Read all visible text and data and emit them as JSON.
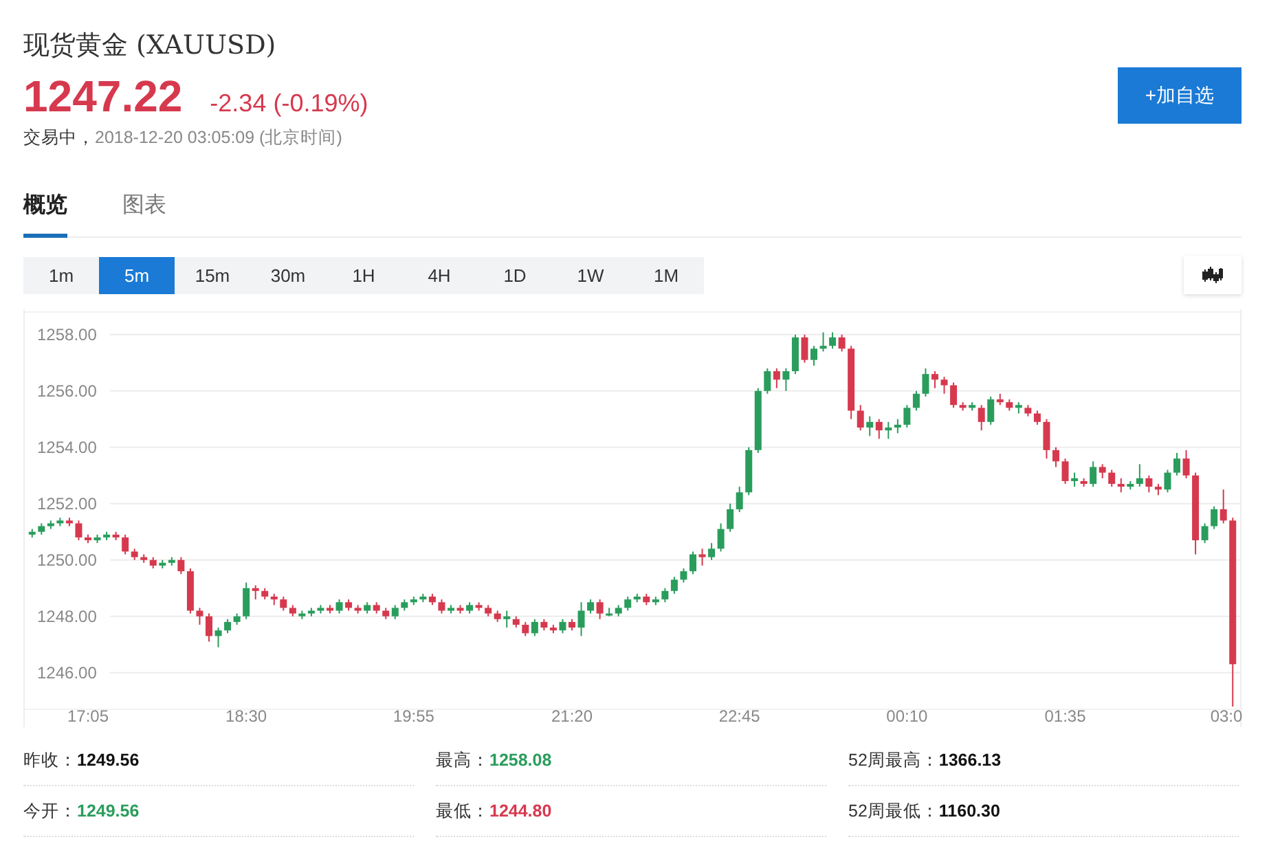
{
  "header": {
    "title": "现货黄金 (XAUUSD)",
    "price": "1247.22",
    "change": "-2.34 (-0.19%)",
    "color": "#d6394e",
    "status": "交易中，",
    "time": "2018-12-20 03:05:09 (北京时间)",
    "button": "+加自选"
  },
  "tabs": [
    {
      "label": "概览",
      "selected": true
    },
    {
      "label": "图表",
      "selected": false
    }
  ],
  "intervals": [
    {
      "label": "1m",
      "selected": false
    },
    {
      "label": "5m",
      "selected": true
    },
    {
      "label": "15m",
      "selected": false
    },
    {
      "label": "30m",
      "selected": false
    },
    {
      "label": "1H",
      "selected": false
    },
    {
      "label": "4H",
      "selected": false
    },
    {
      "label": "1D",
      "selected": false
    },
    {
      "label": "1W",
      "selected": false
    },
    {
      "label": "1M",
      "selected": false
    }
  ],
  "chart": {
    "chart_data": {
      "type": "candlestick",
      "grid": true,
      "ylim": [
        1244.7,
        1258.8
      ],
      "yticks": [
        {
          "value": 1258,
          "label": "1258.00"
        },
        {
          "value": 1256,
          "label": "1256.00"
        },
        {
          "value": 1254,
          "label": "1254.00"
        },
        {
          "value": 1252,
          "label": "1252.00"
        },
        {
          "value": 1250,
          "label": "1250.00"
        },
        {
          "value": 1248,
          "label": "1248.00"
        },
        {
          "value": 1246,
          "label": "1246.00"
        }
      ],
      "categories": [
        null,
        null,
        null,
        null,
        null,
        null,
        "17:05",
        null,
        null,
        null,
        null,
        null,
        null,
        null,
        null,
        null,
        null,
        null,
        null,
        null,
        null,
        null,
        null,
        "18:30",
        null,
        null,
        null,
        null,
        null,
        null,
        null,
        null,
        null,
        null,
        null,
        null,
        null,
        null,
        null,
        null,
        null,
        "19:55",
        null,
        null,
        null,
        null,
        null,
        null,
        null,
        null,
        null,
        null,
        null,
        null,
        null,
        null,
        null,
        null,
        "21:20",
        null,
        null,
        null,
        null,
        null,
        null,
        null,
        null,
        null,
        null,
        null,
        null,
        null,
        null,
        null,
        null,
        null,
        "22:45",
        null,
        null,
        null,
        null,
        null,
        null,
        null,
        null,
        null,
        null,
        null,
        null,
        null,
        null,
        null,
        null,
        null,
        "00:10",
        null,
        null,
        null,
        null,
        null,
        null,
        null,
        null,
        null,
        null,
        null,
        null,
        null,
        null,
        null,
        null,
        "01:35",
        null,
        null,
        null,
        null,
        null,
        null,
        null,
        null,
        null,
        null,
        null,
        null,
        null,
        null,
        null,
        null,
        null,
        "03:0"
      ],
      "ohlc": [
        [
          1250.9,
          1251.1,
          1250.8,
          1251.0
        ],
        [
          1251.0,
          1251.3,
          1250.9,
          1251.2
        ],
        [
          1251.2,
          1251.4,
          1251.1,
          1251.3
        ],
        [
          1251.3,
          1251.5,
          1251.2,
          1251.4
        ],
        [
          1251.4,
          1251.5,
          1251.2,
          1251.3
        ],
        [
          1251.3,
          1251.4,
          1250.7,
          1250.8
        ],
        [
          1250.8,
          1250.9,
          1250.6,
          1250.7
        ],
        [
          1250.7,
          1250.9,
          1250.6,
          1250.8
        ],
        [
          1250.8,
          1251.0,
          1250.7,
          1250.9
        ],
        [
          1250.9,
          1251.0,
          1250.7,
          1250.8
        ],
        [
          1250.8,
          1250.9,
          1250.2,
          1250.3
        ],
        [
          1250.3,
          1250.4,
          1250.0,
          1250.1
        ],
        [
          1250.1,
          1250.2,
          1249.9,
          1250.0
        ],
        [
          1250.0,
          1250.1,
          1249.7,
          1249.8
        ],
        [
          1249.8,
          1250.0,
          1249.7,
          1249.9
        ],
        [
          1249.9,
          1250.1,
          1249.8,
          1250.0
        ],
        [
          1250.0,
          1250.1,
          1249.5,
          1249.6
        ],
        [
          1249.6,
          1249.7,
          1248.1,
          1248.2
        ],
        [
          1248.2,
          1248.3,
          1247.7,
          1248.0
        ],
        [
          1248.0,
          1248.1,
          1247.1,
          1247.3
        ],
        [
          1247.3,
          1247.6,
          1246.9,
          1247.5
        ],
        [
          1247.5,
          1247.9,
          1247.4,
          1247.8
        ],
        [
          1247.8,
          1248.1,
          1247.7,
          1248.0
        ],
        [
          1248.0,
          1249.2,
          1247.9,
          1249.0
        ],
        [
          1249.0,
          1249.1,
          1248.6,
          1248.9
        ],
        [
          1248.9,
          1249.0,
          1248.6,
          1248.7
        ],
        [
          1248.7,
          1248.8,
          1248.4,
          1248.6
        ],
        [
          1248.6,
          1248.7,
          1248.2,
          1248.3
        ],
        [
          1248.3,
          1248.4,
          1248.0,
          1248.1
        ],
        [
          1248.0,
          1248.2,
          1247.9,
          1248.1
        ],
        [
          1248.1,
          1248.3,
          1248.0,
          1248.2
        ],
        [
          1248.2,
          1248.4,
          1248.1,
          1248.3
        ],
        [
          1248.3,
          1248.4,
          1248.1,
          1248.2
        ],
        [
          1248.2,
          1248.6,
          1248.1,
          1248.5
        ],
        [
          1248.5,
          1248.6,
          1248.2,
          1248.3
        ],
        [
          1248.3,
          1248.4,
          1248.1,
          1248.2
        ],
        [
          1248.2,
          1248.5,
          1248.1,
          1248.4
        ],
        [
          1248.4,
          1248.5,
          1248.1,
          1248.2
        ],
        [
          1248.2,
          1248.3,
          1247.9,
          1248.0
        ],
        [
          1248.0,
          1248.4,
          1247.9,
          1248.3
        ],
        [
          1248.3,
          1248.6,
          1248.2,
          1248.5
        ],
        [
          1248.5,
          1248.7,
          1248.4,
          1248.6
        ],
        [
          1248.6,
          1248.8,
          1248.5,
          1248.7
        ],
        [
          1248.7,
          1248.8,
          1248.4,
          1248.5
        ],
        [
          1248.5,
          1248.6,
          1248.1,
          1248.2
        ],
        [
          1248.2,
          1248.4,
          1248.1,
          1248.3
        ],
        [
          1248.3,
          1248.4,
          1248.1,
          1248.2
        ],
        [
          1248.2,
          1248.5,
          1248.1,
          1248.4
        ],
        [
          1248.4,
          1248.5,
          1248.2,
          1248.3
        ],
        [
          1248.3,
          1248.4,
          1248.0,
          1248.1
        ],
        [
          1248.1,
          1248.2,
          1247.8,
          1247.9
        ],
        [
          1247.9,
          1248.2,
          1247.6,
          1248.0
        ],
        [
          1247.9,
          1248.0,
          1247.6,
          1247.7
        ],
        [
          1247.7,
          1247.8,
          1247.3,
          1247.4
        ],
        [
          1247.4,
          1247.9,
          1247.3,
          1247.8
        ],
        [
          1247.8,
          1247.9,
          1247.5,
          1247.6
        ],
        [
          1247.6,
          1247.7,
          1247.4,
          1247.5
        ],
        [
          1247.5,
          1247.9,
          1247.4,
          1247.8
        ],
        [
          1247.8,
          1247.9,
          1247.5,
          1247.6
        ],
        [
          1247.6,
          1248.5,
          1247.3,
          1248.2
        ],
        [
          1248.2,
          1248.6,
          1248.1,
          1248.5
        ],
        [
          1248.5,
          1248.6,
          1247.9,
          1248.1
        ],
        [
          1248.1,
          1248.3,
          1248.0,
          1248.1
        ],
        [
          1248.1,
          1248.4,
          1248.0,
          1248.3
        ],
        [
          1248.3,
          1248.7,
          1248.2,
          1248.6
        ],
        [
          1248.6,
          1248.8,
          1248.5,
          1248.7
        ],
        [
          1248.7,
          1248.8,
          1248.4,
          1248.5
        ],
        [
          1248.5,
          1248.7,
          1248.4,
          1248.6
        ],
        [
          1248.6,
          1249.0,
          1248.5,
          1248.9
        ],
        [
          1248.9,
          1249.4,
          1248.8,
          1249.3
        ],
        [
          1249.3,
          1249.7,
          1249.2,
          1249.6
        ],
        [
          1249.6,
          1250.3,
          1249.5,
          1250.2
        ],
        [
          1250.2,
          1250.4,
          1249.8,
          1250.1
        ],
        [
          1250.1,
          1250.6,
          1250.0,
          1250.4
        ],
        [
          1250.4,
          1251.3,
          1250.3,
          1251.1
        ],
        [
          1251.1,
          1252.0,
          1251.0,
          1251.8
        ],
        [
          1251.8,
          1252.6,
          1251.7,
          1252.4
        ],
        [
          1252.4,
          1254.0,
          1252.3,
          1253.9
        ],
        [
          1253.9,
          1256.1,
          1253.8,
          1256.0
        ],
        [
          1256.0,
          1256.8,
          1255.9,
          1256.7
        ],
        [
          1256.7,
          1256.8,
          1256.1,
          1256.4
        ],
        [
          1256.4,
          1256.8,
          1256.0,
          1256.7
        ],
        [
          1256.7,
          1258.0,
          1256.6,
          1257.9
        ],
        [
          1257.9,
          1258.0,
          1257.0,
          1257.1
        ],
        [
          1257.1,
          1257.6,
          1256.9,
          1257.5
        ],
        [
          1257.5,
          1258.08,
          1257.4,
          1257.6
        ],
        [
          1257.6,
          1258.08,
          1257.5,
          1257.9
        ],
        [
          1257.9,
          1258.0,
          1257.4,
          1257.5
        ],
        [
          1257.5,
          1257.6,
          1255.0,
          1255.3
        ],
        [
          1255.3,
          1255.5,
          1254.6,
          1254.7
        ],
        [
          1254.7,
          1255.1,
          1254.4,
          1254.9
        ],
        [
          1254.9,
          1255.0,
          1254.3,
          1254.6
        ],
        [
          1254.6,
          1254.9,
          1254.3,
          1254.7
        ],
        [
          1254.7,
          1255.0,
          1254.5,
          1254.8
        ],
        [
          1254.8,
          1255.5,
          1254.7,
          1255.4
        ],
        [
          1255.4,
          1256.0,
          1255.3,
          1255.9
        ],
        [
          1255.9,
          1256.8,
          1255.8,
          1256.6
        ],
        [
          1256.6,
          1256.7,
          1256.1,
          1256.4
        ],
        [
          1256.4,
          1256.5,
          1255.9,
          1256.2
        ],
        [
          1256.2,
          1256.3,
          1255.4,
          1255.5
        ],
        [
          1255.5,
          1255.6,
          1255.3,
          1255.4
        ],
        [
          1255.4,
          1255.6,
          1255.3,
          1255.5
        ],
        [
          1255.4,
          1255.5,
          1254.6,
          1254.9
        ],
        [
          1254.9,
          1255.8,
          1254.8,
          1255.7
        ],
        [
          1255.7,
          1255.9,
          1255.5,
          1255.6
        ],
        [
          1255.6,
          1255.7,
          1255.3,
          1255.4
        ],
        [
          1255.4,
          1255.6,
          1255.2,
          1255.5
        ],
        [
          1255.4,
          1255.5,
          1255.1,
          1255.2
        ],
        [
          1255.2,
          1255.3,
          1254.8,
          1254.9
        ],
        [
          1254.9,
          1255.0,
          1253.6,
          1253.9
        ],
        [
          1253.9,
          1254.0,
          1253.3,
          1253.5
        ],
        [
          1253.5,
          1253.6,
          1252.7,
          1252.8
        ],
        [
          1252.8,
          1253.1,
          1252.6,
          1252.9
        ],
        [
          1252.8,
          1252.9,
          1252.6,
          1252.7
        ],
        [
          1252.7,
          1253.5,
          1252.6,
          1253.3
        ],
        [
          1253.3,
          1253.4,
          1252.9,
          1253.1
        ],
        [
          1253.1,
          1253.2,
          1252.6,
          1252.7
        ],
        [
          1252.7,
          1252.9,
          1252.4,
          1252.6
        ],
        [
          1252.6,
          1252.8,
          1252.5,
          1252.7
        ],
        [
          1252.7,
          1253.4,
          1252.6,
          1252.9
        ],
        [
          1252.9,
          1253.0,
          1252.4,
          1252.6
        ],
        [
          1252.6,
          1252.7,
          1252.3,
          1252.5
        ],
        [
          1252.5,
          1253.2,
          1252.4,
          1253.1
        ],
        [
          1253.1,
          1253.8,
          1253.0,
          1253.6
        ],
        [
          1253.6,
          1253.9,
          1252.9,
          1253.0
        ],
        [
          1253.0,
          1253.1,
          1250.2,
          1250.7
        ],
        [
          1250.7,
          1251.3,
          1250.6,
          1251.2
        ],
        [
          1251.2,
          1251.9,
          1251.1,
          1251.8
        ],
        [
          1251.8,
          1252.5,
          1251.3,
          1251.4
        ],
        [
          1251.4,
          1251.5,
          1244.8,
          1246.3
        ]
      ]
    }
  },
  "stats": [
    {
      "label": "昨收：",
      "value": "1249.56",
      "color": "#111111"
    },
    {
      "label": "最高：",
      "value": "1258.08",
      "color": "#2a9d5c"
    },
    {
      "label": "52周最高：",
      "value": "1366.13",
      "color": "#111111"
    },
    {
      "label": "今开：",
      "value": "1249.56",
      "color": "#2a9d5c"
    },
    {
      "label": "最低：",
      "value": "1244.80",
      "color": "#d6394e"
    },
    {
      "label": "52周最低：",
      "value": "1160.30",
      "color": "#111111"
    }
  ]
}
